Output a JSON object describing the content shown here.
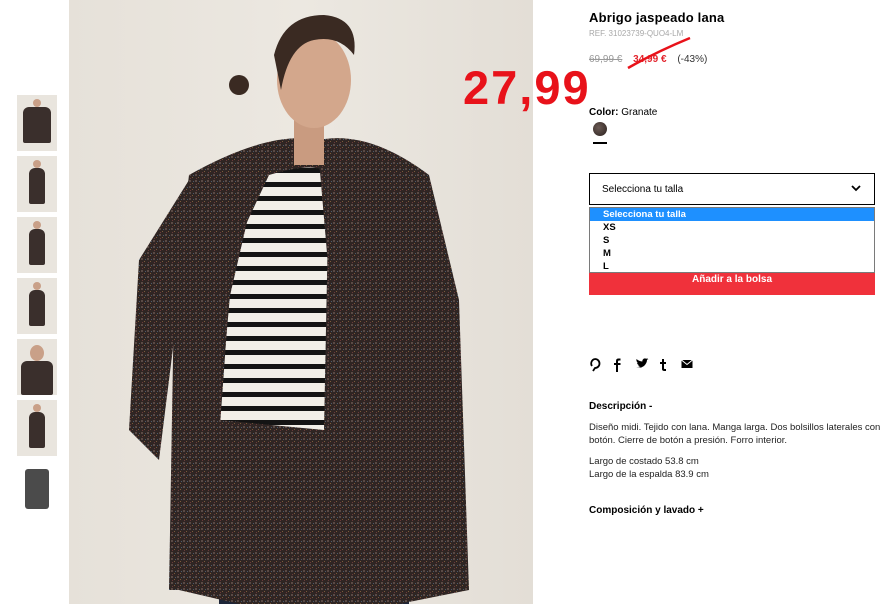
{
  "product": {
    "title": "Abrigo jaspeado lana",
    "ref": "REF. 31023739-QUO4-LM",
    "old_price": "69,99 €",
    "sale_price": "34,99 €",
    "discount": "(-43%)",
    "annotated_price": "27,99"
  },
  "color": {
    "label": "Color:",
    "value": "Granate",
    "swatch": "#3a2d29"
  },
  "size": {
    "select_label": "Selecciona tu talla",
    "options": [
      "Selecciona tu talla",
      "XS",
      "S",
      "M",
      "L"
    ]
  },
  "actions": {
    "add_to_bag": "Añadir a la bolsa"
  },
  "share_icons": [
    "pinterest-icon",
    "facebook-icon",
    "twitter-icon",
    "tumblr-icon",
    "mail-icon"
  ],
  "description": {
    "heading": "Descripción -",
    "text": "Diseño midi. Tejido con lana. Manga larga. Dos bolsillos laterales con botón. Cierre de botón a presión. Forro interior.",
    "measure1": "Largo de costado 53.8 cm",
    "measure2": "Largo de la espalda 83.9 cm"
  },
  "composition": {
    "heading": "Composición y lavado +"
  },
  "colors": {
    "accent_red": "#f0313b",
    "selected_blue": "#1e90ff"
  }
}
